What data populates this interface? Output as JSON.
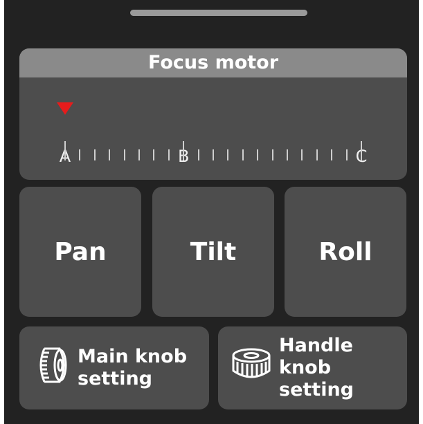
{
  "focus_motor": {
    "title": "Focus motor",
    "labels": [
      "A",
      "B",
      "C"
    ]
  },
  "axis_buttons": {
    "pan": "Pan",
    "tilt": "Tilt",
    "roll": "Roll"
  },
  "knob_buttons": {
    "main": {
      "line1": "Main knob",
      "line2": "setting",
      "icon": "main-knob-icon"
    },
    "handle": {
      "line1": "Handle knob",
      "line2": "setting",
      "icon": "handle-knob-icon"
    }
  },
  "colors": {
    "background": "#222222",
    "card": "#4d4d4d",
    "title_bar": "#8a8a8a",
    "marker": "#e51c1c",
    "text": "#ffffff"
  }
}
